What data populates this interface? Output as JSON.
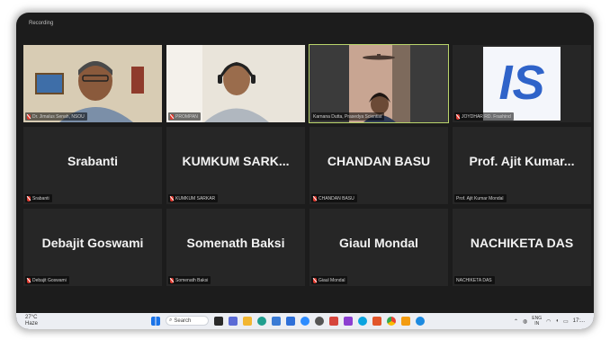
{
  "window": {
    "recording_label": "Recording"
  },
  "tiles": [
    {
      "tag": "Dr. Jimalus Senah, NSOU",
      "active": false
    },
    {
      "tag": "PROMPAN",
      "active": false
    },
    {
      "tag": "Karnana Dutta, Prasedya Scientist",
      "active": true
    },
    {
      "tag": "JOYDHAR RD. Frashind",
      "active": false,
      "logo": "IS"
    },
    {
      "name": "Srabanti",
      "tag": "Srabanti"
    },
    {
      "name": "KUMKUM  SARK...",
      "tag": "KUMKUM SARKAR"
    },
    {
      "name": "CHANDAN BASU",
      "tag": "CHANDAN BASU"
    },
    {
      "name": "Prof. Ajit Kumar...",
      "tag": "Prof. Ajit Kumar Mondal"
    },
    {
      "name": "Debajit Goswami",
      "tag": "Debajit Goswami"
    },
    {
      "name": "Somenath Baksi",
      "tag": "Somenath Baksi"
    },
    {
      "name": "Giaul Mondal",
      "tag": "Giaul Mondal"
    },
    {
      "name": "NACHIKETA DAS",
      "tag": "NACHIKETA DAS"
    }
  ],
  "taskbar": {
    "weather_temp": "27°C",
    "weather_desc": "Haze",
    "search_label": "Search",
    "lang_top": "ENG",
    "lang_bottom": "IN",
    "time": "17:..."
  },
  "colors": {
    "active_border": "#b9d46b",
    "frame": "#1c1c1c",
    "tile": "#262626",
    "muted_mic": "#e0392e"
  }
}
